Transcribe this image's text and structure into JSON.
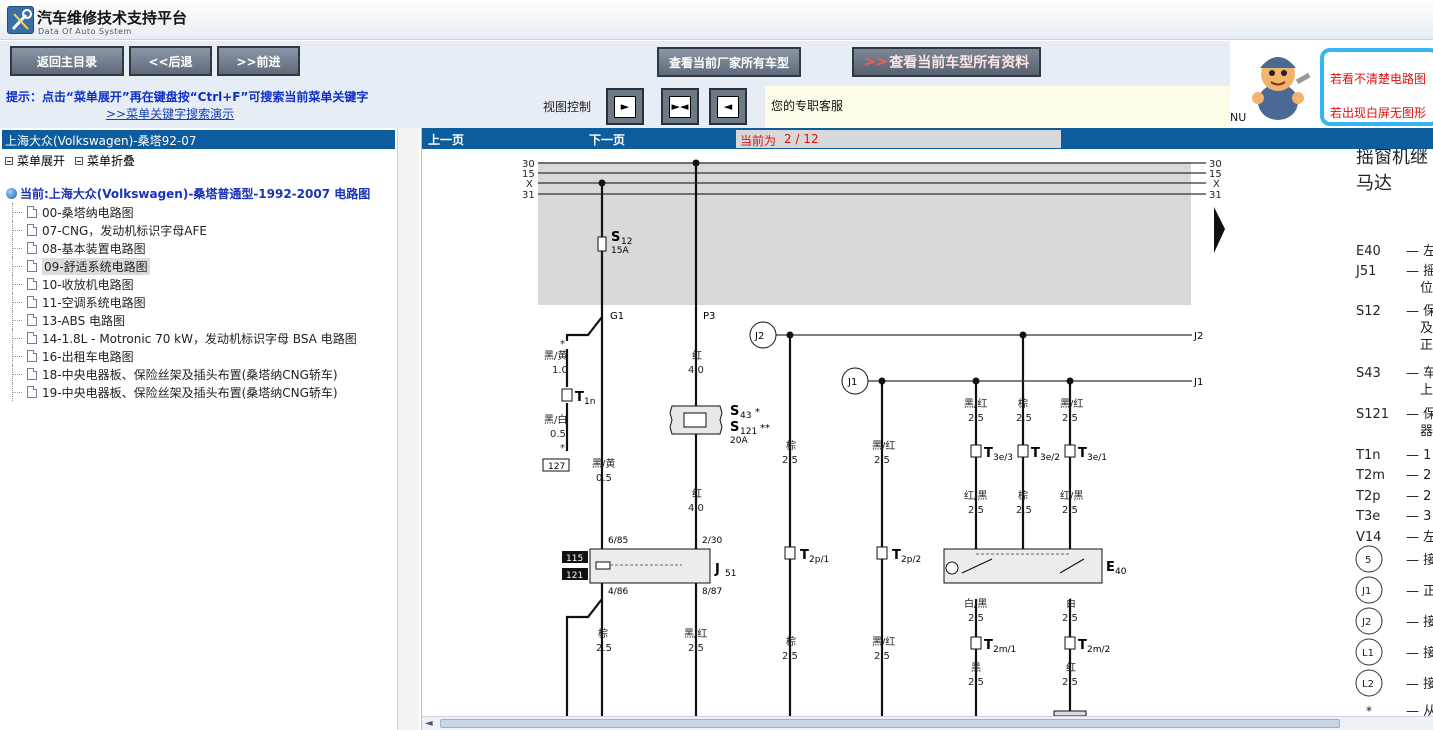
{
  "app": {
    "title": "汽车维修技术支持平台",
    "subtitle": "Data Of Auto System"
  },
  "toolbar": {
    "home_label": "返回主目录",
    "back_label": "<<后退",
    "forward_label": ">>前进",
    "all_models_label": "查看当前厂家所有车型",
    "all_docs_arrows": ">>",
    "all_docs_label": "查看当前车型所有资料"
  },
  "hint": {
    "line1": "提示：点击“菜单展开”再在键盘按“Ctrl+F”可搜索当前菜单关键字",
    "line2": ">>菜单关键字搜索演示"
  },
  "view_control": {
    "label": "视图控制",
    "buttons": [
      "►",
      "►◄",
      "◄"
    ]
  },
  "service": {
    "text": "您的专职客服"
  },
  "ad": {
    "nu": "NU",
    "line1": "若看不清楚电路图",
    "line2": "若出现白屏无图形"
  },
  "sidebar": {
    "breadcrumb": "上海大众(Volkswagen)-桑塔92-07",
    "expand_label": "菜单展开",
    "collapse_label": "菜单折叠",
    "current": "当前:上海大众(Volkswagen)-桑塔普通型-1992-2007 电路图",
    "items": [
      {
        "label": "00-桑塔纳电路图"
      },
      {
        "label": "07-CNG，发动机标识字母AFE"
      },
      {
        "label": "08-基本装置电路图"
      },
      {
        "label": "09-舒适系统电路图"
      },
      {
        "label": "10-收放机电路图"
      },
      {
        "label": "11-空调系统电路图"
      },
      {
        "label": "13-ABS 电路图"
      },
      {
        "label": "14-1.8L - Motronic 70 kW，发动机标识字母 BSA 电路图"
      },
      {
        "label": "16-出租车电路图"
      },
      {
        "label": "18-中央电器板、保险丝架及插头布置(桑塔纳CNG轿车)"
      },
      {
        "label": "19-中央电器板、保险丝架及插头布置(桑塔纳CNG轿车)"
      }
    ],
    "active_index": 3
  },
  "viewer": {
    "prev_label": "上一页",
    "next_label": "下一页",
    "page_label": "当前为",
    "page_value": "2 / 12"
  },
  "diagram": {
    "rails": [
      "30",
      "15",
      "X",
      "31"
    ],
    "fuse_name": "S",
    "fuse_sub": "12",
    "fuse_rating": "15A",
    "pin_g1": "G1",
    "pin_p3": "P3",
    "j2": "J2",
    "j1": "J1",
    "w1_color": "黑/黄",
    "w1_size": "1.0",
    "t1n": "T",
    "t1n_sub": "1n",
    "w2_color": "黑/白",
    "w2_size": "0.5",
    "star": "*",
    "box127": "127",
    "w3_color": "黑/黄",
    "w3_size": "0.5",
    "p3_color": "红",
    "p3_size": "4.0",
    "s43": "S",
    "s43_sub": "43",
    "s43_star": "*",
    "s121": "S",
    "s121_sub": "121",
    "s121_star": "**",
    "s121_rating": "20A",
    "p3b_color": "红",
    "p3b_size": "4.0",
    "j51_pin1": "6/85",
    "j51_pin2": "2/30",
    "j51_pin3": "4/86",
    "j51_pin4": "8/87",
    "box115": "115",
    "box121": "121",
    "j51": "J",
    "j51_sub": "51",
    "g1b_color": "棕",
    "g1b_size": "2.5",
    "p3c_color": "黑/红",
    "p3c_size": "2.5",
    "c2_color": "棕",
    "c2_size": "2.5",
    "c2b_color": "棕",
    "c2b_size": "2.5",
    "t2p1": "T",
    "t2p1_sub": "2p/1",
    "c3_color": "黑/红",
    "c3_size": "2.5",
    "c3b_color": "黑/红",
    "c3b_size": "2.5",
    "t2p2": "T",
    "t2p2_sub": "2p/2",
    "e_a_color": "黑/红",
    "e_a_size": "2.5",
    "e_b_color": "棕",
    "e_b_size": "2.5",
    "e_c_color": "黑/红",
    "e_c_size": "2.5",
    "t3e3": "T",
    "t3e3_sub": "3e/3",
    "t3e2": "T",
    "t3e2_sub": "3e/2",
    "t3e1": "T",
    "t3e1_sub": "3e/1",
    "e_a2_color": "红/黑",
    "e_a2_size": "2.5",
    "e_b2_color": "棕",
    "e_b2_size": "2.5",
    "e_c2_color": "红/黑",
    "e_c2_size": "2.5",
    "e40": "E",
    "e40_sub": "40",
    "m1_color": "白/黑",
    "m1_size": "2.5",
    "m2_color": "白",
    "m2_size": "2.5",
    "t2m1": "T",
    "t2m1_sub": "2m/1",
    "t2m2": "T",
    "t2m2_sub": "2m/2",
    "m1b_color": "黑",
    "m1b_size": "2.5",
    "m2b_color": "红",
    "m2b_size": "2.5"
  },
  "legend": {
    "title1": "摇窗机继",
    "title2": "马达",
    "rows": [
      {
        "code": "E40",
        "desc": "— 左"
      },
      {
        "code": "J51",
        "desc": "— 摇"
      },
      {
        "code": "",
        "desc": "位"
      },
      {
        "code": "S12",
        "desc": "— 保"
      },
      {
        "code": "",
        "desc": "及"
      },
      {
        "code": "",
        "desc": "正"
      },
      {
        "code": "S43",
        "desc": "— 车"
      },
      {
        "code": "",
        "desc": "上"
      },
      {
        "code": "S121",
        "desc": "— 保"
      },
      {
        "code": "",
        "desc": "器"
      },
      {
        "code": "T1n",
        "desc": "— 1"
      },
      {
        "code": "T2m",
        "desc": "— 2"
      },
      {
        "code": "T2p",
        "desc": "— 2"
      },
      {
        "code": "T3e",
        "desc": "— 3"
      },
      {
        "code": "V14",
        "desc": "— 左"
      }
    ],
    "circles": [
      {
        "code": "5",
        "desc": "— 接"
      },
      {
        "code": "J1",
        "desc": "— 正"
      },
      {
        "code": "J2",
        "desc": "— 接"
      },
      {
        "code": "L1",
        "desc": "— 接"
      },
      {
        "code": "L2",
        "desc": "— 接"
      }
    ],
    "last_star": "*",
    "last_desc": "— 从"
  }
}
